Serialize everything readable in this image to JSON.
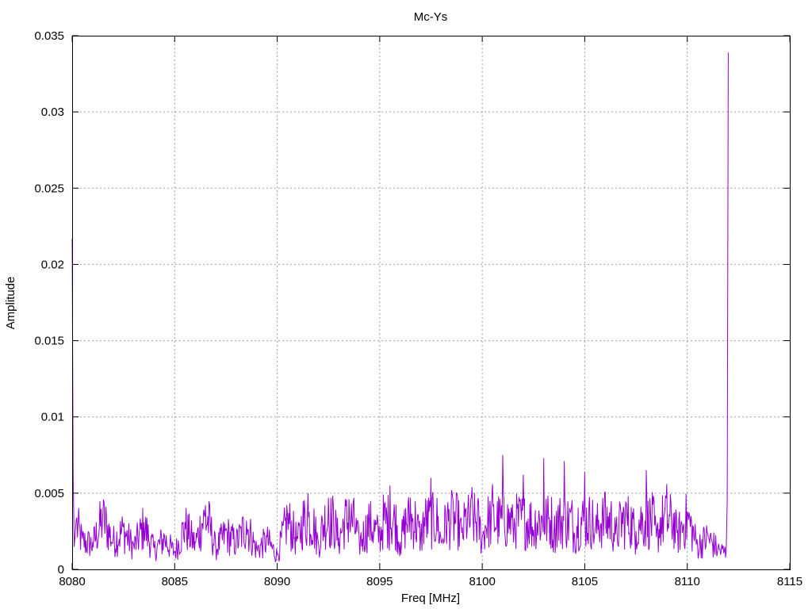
{
  "chart_data": {
    "type": "line",
    "title": "Mc-Ys",
    "xlabel": "Freq [MHz]",
    "ylabel": "Amplitude",
    "xlim": [
      8080,
      8115
    ],
    "ylim": [
      0,
      0.035
    ],
    "x_ticks": [
      "8080",
      "8085",
      "8090",
      "8095",
      "8100",
      "8105",
      "8110",
      "8115"
    ],
    "y_ticks": [
      "0",
      "0.005",
      "0.01",
      "0.015",
      "0.02",
      "0.025",
      "0.03",
      "0.035"
    ],
    "grid": true,
    "line_color": "#9400d3",
    "series": [
      {
        "x": [
          8080.0,
          8080.05,
          8080.1,
          8080.2,
          8080.5,
          8081.0,
          8081.5,
          8082.0,
          8082.5,
          8083.0,
          8083.5,
          8084.0,
          8084.5,
          8085.0,
          8085.5,
          8086.0,
          8086.5,
          8087.0,
          8087.5,
          8088.0,
          8088.5,
          8089.0,
          8089.5,
          8090.0,
          8090.5,
          8091.0,
          8091.5,
          8092.0,
          8092.5,
          8093.0,
          8093.5,
          8094.0,
          8094.5,
          8095.0,
          8095.5,
          8096.0,
          8096.5,
          8097.0,
          8097.5,
          8098.0,
          8098.5,
          8099.0,
          8099.5,
          8100.0,
          8100.5,
          8101.0,
          8101.5,
          8102.0,
          8102.5,
          8103.0,
          8103.5,
          8104.0,
          8104.5,
          8105.0,
          8105.5,
          8106.0,
          8106.5,
          8107.0,
          8107.5,
          8108.0,
          8108.5,
          8109.0,
          8109.5,
          8110.0,
          8110.5,
          8111.0,
          8111.5,
          8111.9,
          8111.95,
          8112.0
        ],
        "y": [
          0.0217,
          0.006,
          0.0015,
          0.0033,
          0.002,
          0.0018,
          0.0037,
          0.002,
          0.0028,
          0.0016,
          0.0031,
          0.0014,
          0.0022,
          0.0012,
          0.0031,
          0.0018,
          0.0042,
          0.0015,
          0.0026,
          0.0019,
          0.0032,
          0.0014,
          0.0021,
          0.001,
          0.0036,
          0.002,
          0.005,
          0.0018,
          0.0047,
          0.0021,
          0.0046,
          0.0019,
          0.0033,
          0.0024,
          0.0055,
          0.0018,
          0.0047,
          0.0022,
          0.006,
          0.0019,
          0.0052,
          0.0024,
          0.0054,
          0.0021,
          0.0056,
          0.0075,
          0.0028,
          0.0062,
          0.0026,
          0.0073,
          0.0024,
          0.0071,
          0.0023,
          0.0064,
          0.0025,
          0.0051,
          0.0023,
          0.0044,
          0.0025,
          0.0065,
          0.0021,
          0.0056,
          0.0024,
          0.0038,
          0.0017,
          0.0023,
          0.0014,
          0.0012,
          0.0045,
          0.0339
        ]
      }
    ]
  }
}
